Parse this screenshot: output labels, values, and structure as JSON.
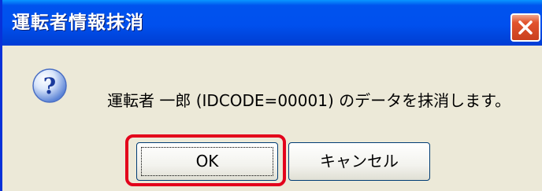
{
  "dialog": {
    "title": "運転者情報抹消",
    "close_icon": "close-icon",
    "message_icon": "question-icon",
    "message": "運転者 一郎 (IDCODE=00001) のデータを抹消します。"
  },
  "buttons": {
    "ok_label": "OK",
    "cancel_label": "キャンセル"
  },
  "colors": {
    "titlebar": "#0053EE",
    "dialog_body": "#ECE9D8",
    "close_button": "#E2542E",
    "highlight": "#E3001B"
  }
}
